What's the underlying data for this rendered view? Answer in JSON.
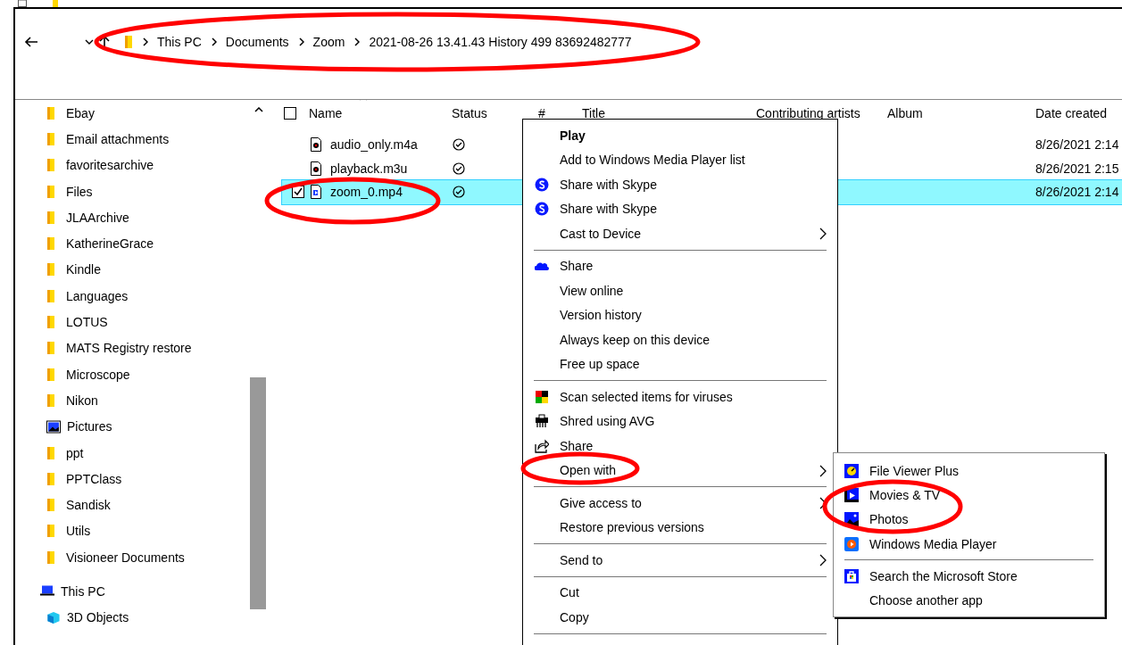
{
  "address_bar": {
    "path": [
      "This PC",
      "Documents",
      "Zoom",
      "2021-08-26 13.41.43 History 499 83692482777"
    ]
  },
  "sidebar": {
    "items": [
      {
        "label": "Ebay",
        "kind": "folder"
      },
      {
        "label": "Email attachments",
        "kind": "folder"
      },
      {
        "label": "favoritesarchive",
        "kind": "folder"
      },
      {
        "label": "Files",
        "kind": "folder"
      },
      {
        "label": "JLAArchive",
        "kind": "folder"
      },
      {
        "label": "KatherineGrace",
        "kind": "folder"
      },
      {
        "label": "Kindle",
        "kind": "folder"
      },
      {
        "label": "Languages",
        "kind": "folder"
      },
      {
        "label": "LOTUS",
        "kind": "folder"
      },
      {
        "label": "MATS Registry restore",
        "kind": "folder"
      },
      {
        "label": "Microscope",
        "kind": "folder"
      },
      {
        "label": "Nikon",
        "kind": "folder"
      },
      {
        "label": "Pictures",
        "kind": "pictures"
      },
      {
        "label": "ppt",
        "kind": "folder"
      },
      {
        "label": "PPTClass",
        "kind": "folder"
      },
      {
        "label": "Sandisk",
        "kind": "folder"
      },
      {
        "label": "Utils",
        "kind": "folder"
      },
      {
        "label": "Visioneer Documents",
        "kind": "folder"
      }
    ],
    "tree": [
      {
        "label": "This PC",
        "kind": "pc",
        "children": [
          {
            "label": "3D Objects",
            "kind": "cube"
          }
        ]
      }
    ]
  },
  "file_list": {
    "select_all_checked": false,
    "columns": [
      {
        "label": "Name",
        "sorted": true
      },
      {
        "label": "Status",
        "sorted": false
      },
      {
        "label": "#",
        "sorted": false
      },
      {
        "label": "Title",
        "sorted": false
      },
      {
        "label": "Contributing artists",
        "sorted": false
      },
      {
        "label": "Album",
        "sorted": false
      },
      {
        "label": "Date created",
        "sorted": false
      }
    ],
    "rows": [
      {
        "name": "audio_only.m4a",
        "kind": "audio",
        "synced": true,
        "date_created": "8/26/2021 2:14",
        "selected": false
      },
      {
        "name": "playback.m3u",
        "kind": "audio",
        "synced": true,
        "date_created": "8/26/2021 2:15",
        "selected": false
      },
      {
        "name": "zoom_0.mp4",
        "kind": "video",
        "synced": true,
        "date_created": "8/26/2021 2:14",
        "selected": true
      }
    ]
  },
  "context_menu": {
    "groups": [
      [
        {
          "label": "Play",
          "default": true,
          "submenu": false
        },
        {
          "label": "Add to Windows Media Player list",
          "default": false,
          "submenu": false
        },
        {
          "label": "Share with Skype",
          "kind": "skype",
          "default": false,
          "submenu": false
        },
        {
          "label": "Share with Skype",
          "kind": "skype",
          "default": false,
          "submenu": false
        },
        {
          "label": "Cast to Device",
          "default": false,
          "submenu": true
        }
      ],
      [
        {
          "label": "Share",
          "kind": "cloud",
          "default": false,
          "submenu": false
        },
        {
          "label": "View online",
          "default": false,
          "submenu": false
        },
        {
          "label": "Version history",
          "default": false,
          "submenu": false
        },
        {
          "label": "Always keep on this device",
          "default": false,
          "submenu": false
        },
        {
          "label": "Free up space",
          "default": false,
          "submenu": false
        }
      ],
      [
        {
          "label": "Scan selected items for viruses",
          "kind": "antivirus",
          "default": false,
          "submenu": false
        },
        {
          "label": "Shred using AVG",
          "kind": "shredder",
          "default": false,
          "submenu": false
        },
        {
          "label": "Share",
          "kind": "share",
          "default": false,
          "submenu": false
        },
        {
          "label": "Open with",
          "default": false,
          "submenu": true
        }
      ],
      [
        {
          "label": "Give access to",
          "default": false,
          "submenu": true
        },
        {
          "label": "Restore previous versions",
          "default": false,
          "submenu": false
        }
      ],
      [
        {
          "label": "Send to",
          "default": false,
          "submenu": true
        }
      ],
      [
        {
          "label": "Cut",
          "default": false,
          "submenu": false
        },
        {
          "label": "Copy",
          "default": false,
          "submenu": false
        }
      ]
    ]
  },
  "open_with_menu": {
    "groups": [
      [
        {
          "label": "File Viewer Plus",
          "kind": "viewer"
        },
        {
          "label": "Movies & TV",
          "kind": "movies"
        },
        {
          "label": "Photos",
          "kind": "photos"
        },
        {
          "label": "Windows Media Player",
          "kind": "wmp"
        }
      ],
      [
        {
          "label": "Search the Microsoft Store",
          "kind": "store"
        },
        {
          "label": "Choose another app",
          "kind": "none"
        }
      ]
    ]
  }
}
